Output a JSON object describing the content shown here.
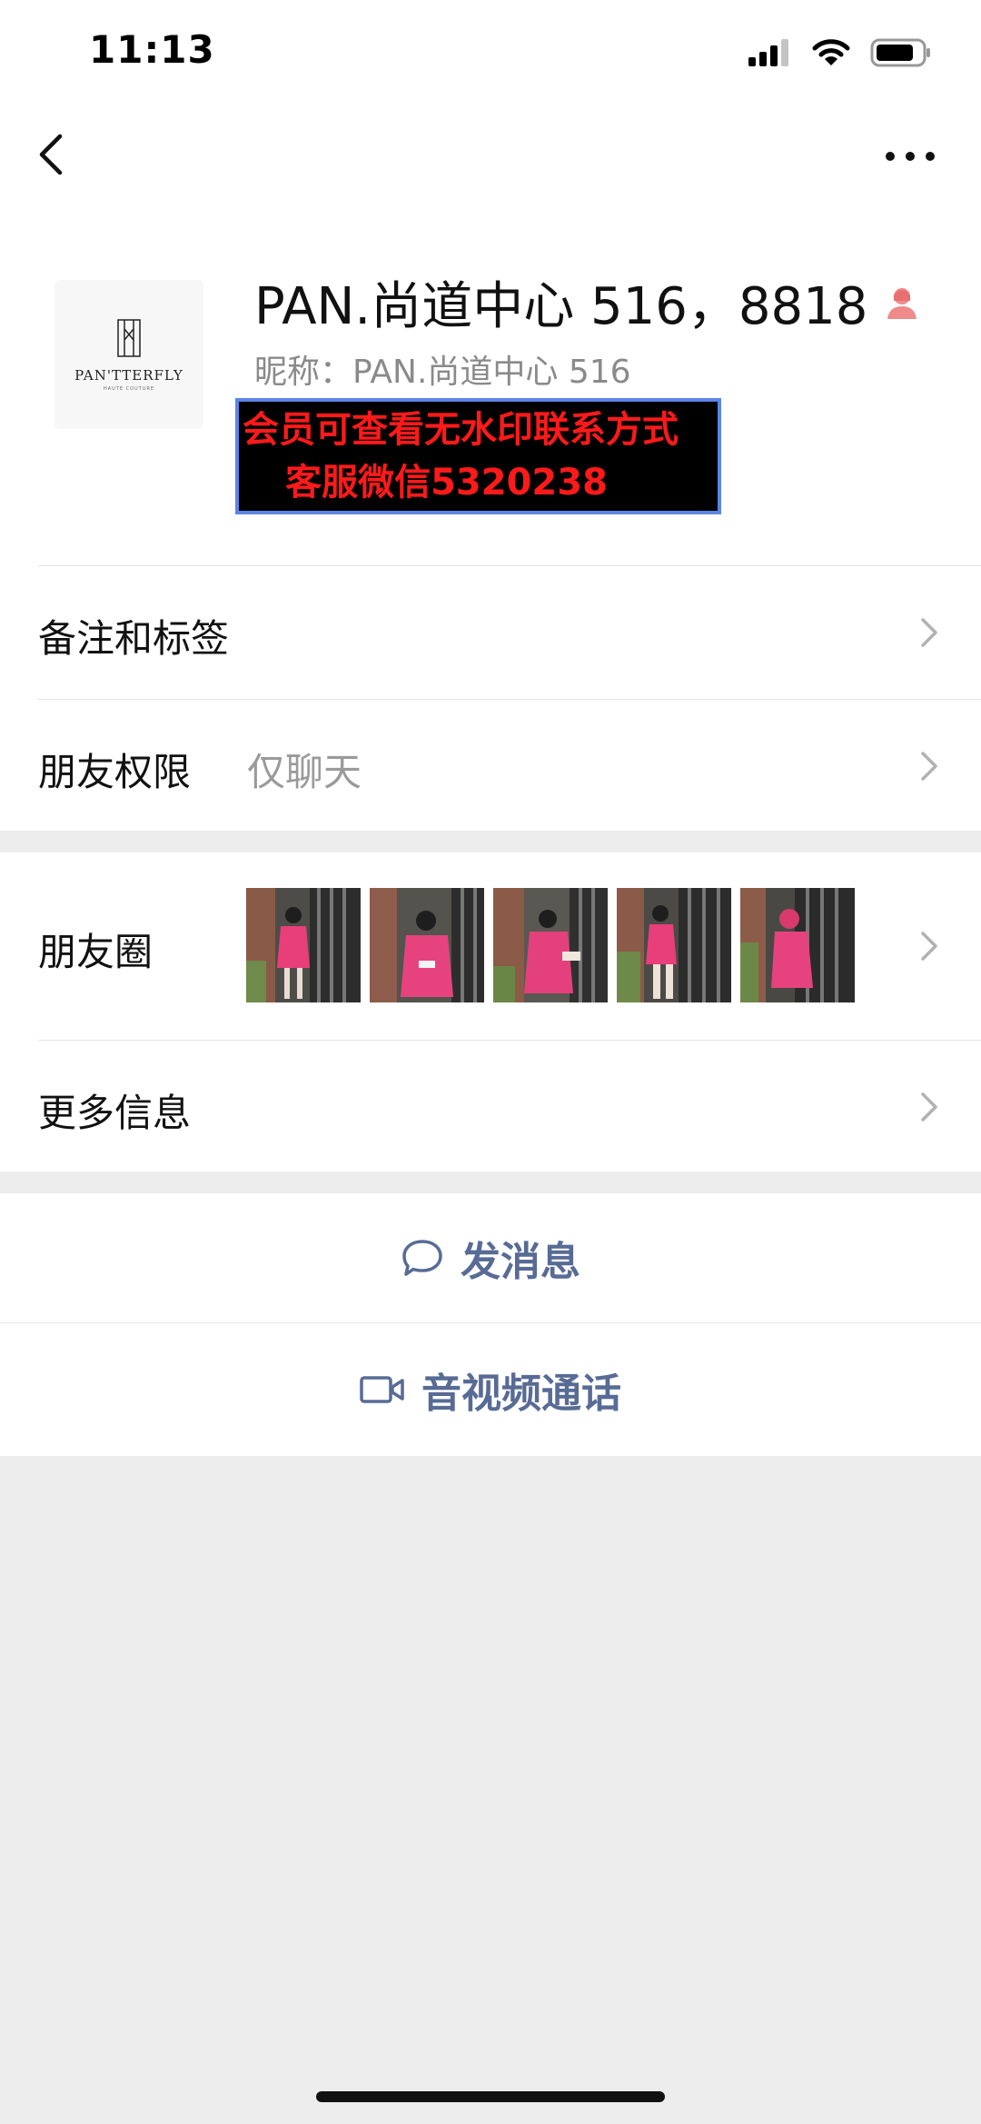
{
  "status_bar": {
    "time": "11:13",
    "icons": [
      "cellular-signal-icon",
      "wifi-icon",
      "battery-icon"
    ]
  },
  "nav": {
    "back_icon": "chevron-left-icon",
    "more_icon": "more-dots-icon"
  },
  "profile": {
    "avatar_brand": "PAN'TTERFLY",
    "avatar_subtitle": "HAUTE COUTURE",
    "display_name": "PAN.尚道中心 516，8818",
    "gender_icon": "female-person-icon",
    "nickname_label": "昵称：",
    "nickname": "PAN.尚道中心 516"
  },
  "watermark": {
    "line1": "会员可查看无水印联系方式",
    "line2": "客服微信5320238"
  },
  "rows": {
    "remarks": {
      "label": "备注和标签"
    },
    "permissions": {
      "label": "朋友权限",
      "value": "仅聊天"
    },
    "moments": {
      "label": "朋友圈",
      "photo_count": 5
    },
    "more_info": {
      "label": "更多信息"
    }
  },
  "actions": {
    "message": {
      "label": "发消息",
      "icon": "chat-bubble-icon"
    },
    "call": {
      "label": "音视频通话",
      "icon": "video-camera-icon"
    }
  },
  "colors": {
    "link_blue": "#576b95",
    "watermark_red": "#ff1a1a",
    "gender_pink": "#f08a8a",
    "page_gray": "#ededed"
  }
}
